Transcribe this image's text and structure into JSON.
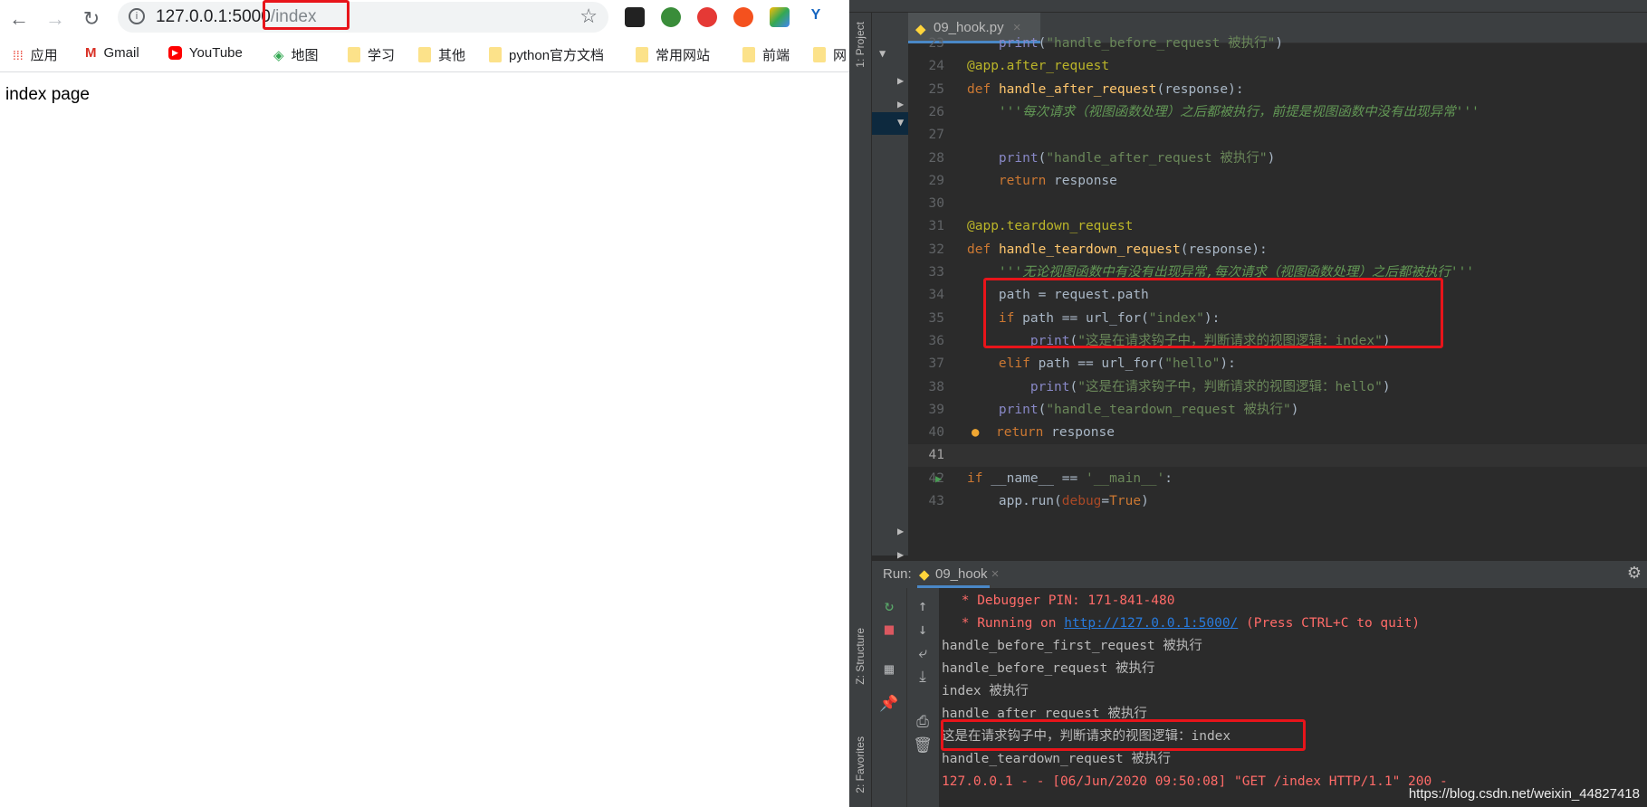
{
  "browser": {
    "url_host": "127.0.0.1:5000",
    "url_path": "/index",
    "bookmarks": [
      {
        "label": "应用",
        "icon": "apps-grid-icon"
      },
      {
        "label": "Gmail",
        "icon": "gmail-icon"
      },
      {
        "label": "YouTube",
        "icon": "youtube-icon"
      },
      {
        "label": "地图",
        "icon": "maps-icon"
      },
      {
        "label": "学习",
        "icon": "folder-icon"
      },
      {
        "label": "其他",
        "icon": "folder-icon"
      },
      {
        "label": "python官方文档",
        "icon": "folder-icon"
      },
      {
        "label": "常用网站",
        "icon": "folder-icon"
      },
      {
        "label": "前端",
        "icon": "folder-icon"
      },
      {
        "label": "网",
        "icon": "folder-icon"
      }
    ],
    "page_text": "index page",
    "highlight_color": "#e8141a"
  },
  "ide": {
    "project_label": "1: Project",
    "structure_label": "Z: Structure",
    "favorites_label": "2: Favorites",
    "file_tab": "09_hook.py",
    "run_config": "09_hook",
    "code_lines": [
      {
        "n": "23",
        "html": "    <span class='bi'>print</span>(<span class='str'>\"handle_before_request 被执行\"</span>)"
      },
      {
        "n": "24",
        "html": "<span class='dec'>@app.after_request</span>"
      },
      {
        "n": "25",
        "html": "<span class='kw'>def</span> <span class='fn'>handle_after_request</span>(response):"
      },
      {
        "n": "26",
        "html": "    <span class='doc'>'''每次请求（视图函数处理）之后都被执行，前提是视图函数中没有出现异常'''</span>"
      },
      {
        "n": "27",
        "html": ""
      },
      {
        "n": "28",
        "html": "    <span class='bi'>print</span>(<span class='str'>\"handle_after_request 被执行\"</span>)"
      },
      {
        "n": "29",
        "html": "    <span class='kw'>return</span> response"
      },
      {
        "n": "30",
        "html": ""
      },
      {
        "n": "31",
        "html": "<span class='dec'>@app.teardown_request</span>"
      },
      {
        "n": "32",
        "html": "<span class='kw'>def</span> <span class='fn'>handle_teardown_request</span>(response):"
      },
      {
        "n": "33",
        "html": "    <span class='doc'>'''无论视图函数中有没有出现异常,每次请求（视图函数处理）之后都被执行'''</span>"
      },
      {
        "n": "34",
        "html": "    path = request.path"
      },
      {
        "n": "35",
        "html": "    <span class='kw'>if</span> path == url_for(<span class='str'>\"index\"</span>):"
      },
      {
        "n": "36",
        "html": "        <span class='bi'>print</span>(<span class='str'>\"这是在请求钩子中，判断请求的视图逻辑：index\"</span>)"
      },
      {
        "n": "37",
        "html": "    <span class='kw'>elif</span> path == url_for(<span class='str'>\"hello\"</span>):"
      },
      {
        "n": "38",
        "html": "        <span class='bi'>print</span>(<span class='str'>\"这是在请求钩子中，判断请求的视图逻辑：hello\"</span>)"
      },
      {
        "n": "39",
        "html": "    <span class='bi'>print</span>(<span class='str'>\"handle_teardown_request 被执行\"</span>)"
      },
      {
        "n": "40",
        "html": "    <span class='kw'>return</span> response"
      },
      {
        "n": "41",
        "html": ""
      },
      {
        "n": "42",
        "html": "<span class='kw'>if</span> __name__ == <span class='str'>'__main__'</span>:"
      },
      {
        "n": "43",
        "html": "    app.run(<span class='par'>debug</span>=<span class='kw'>True</span>)"
      }
    ],
    "run": {
      "label": "Run:",
      "debugger_pin": " * Debugger PIN: 171-841-480",
      "running_prefix": " * Running on ",
      "running_link": "http://127.0.0.1:5000/",
      "running_suffix": " (Press CTRL+C to quit)",
      "lines": [
        "handle_before_first_request 被执行",
        "handle_before_request 被执行",
        "index 被执行",
        "handle_after_request 被执行",
        "这是在请求钩子中，判断请求的视图逻辑：index",
        "handle_teardown_request 被执行"
      ],
      "access_log": "127.0.0.1 - - [06/Jun/2020 09:50:08] \"GET /index HTTP/1.1\" 200 -"
    },
    "watermark": "https://blog.csdn.net/weixin_44827418"
  }
}
